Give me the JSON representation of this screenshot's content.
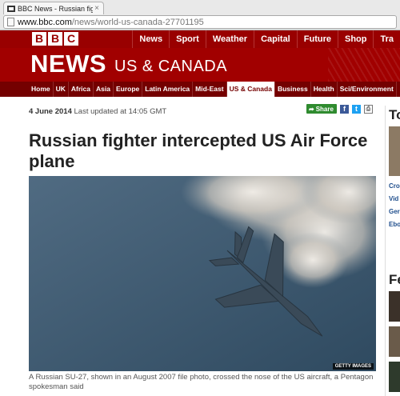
{
  "browser": {
    "tab_title": "BBC News - Russian fighte",
    "tab_close": "×",
    "url_host": "www.bbc.com",
    "url_path": "/news/world-us-canada-27701195"
  },
  "bbc": {
    "logo": [
      "B",
      "B",
      "C"
    ],
    "topnav": [
      "News",
      "Sport",
      "Weather",
      "Capital",
      "Future",
      "Shop",
      "Tra"
    ]
  },
  "masthead": {
    "news": "NEWS",
    "region": "US & CANADA"
  },
  "sections": {
    "items": [
      "Home",
      "UK",
      "Africa",
      "Asia",
      "Europe",
      "Latin America",
      "Mid-East",
      "US & Canada",
      "Business",
      "Health",
      "Sci/Environment"
    ],
    "active": "US & Canada"
  },
  "article": {
    "date": "4 June 2014",
    "updated": "Last updated at 14:05 GMT",
    "share_label": "Share",
    "headline": "Russian fighter intercepted US Air Force plane",
    "image_credit": "GETTY IMAGES",
    "caption": "A Russian SU-27, shown in an August 2007 file photo, crossed the nose of the US aircraft, a Pentagon spokesman said"
  },
  "rail": {
    "heading_top": "To",
    "links": [
      "Cro",
      "Vid",
      "Ger",
      "Ebo"
    ],
    "heading_features": "Fe"
  },
  "colors": {
    "bbc_red": "#990000",
    "section_nav": "#740000",
    "share_green": "#2f8b2f"
  }
}
